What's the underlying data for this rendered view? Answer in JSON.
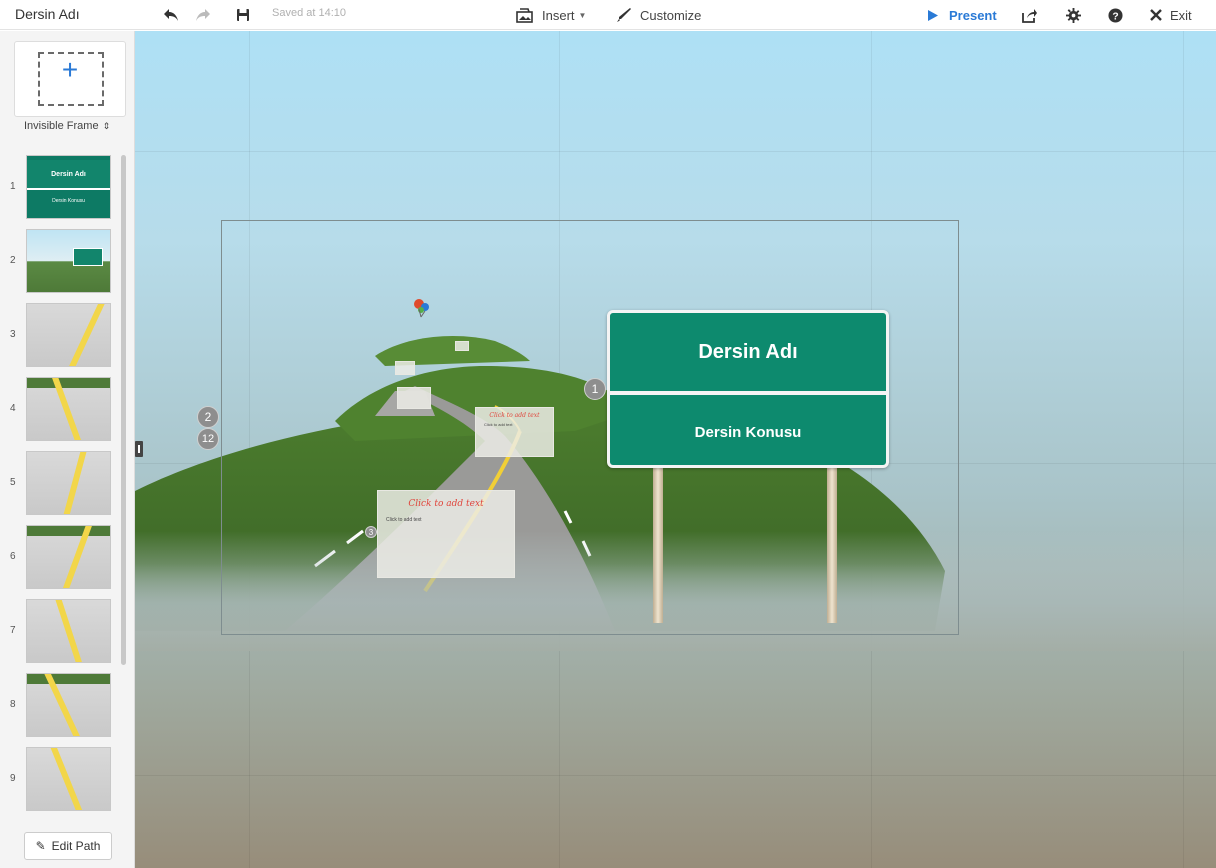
{
  "app": {
    "title": "Dersin Adı"
  },
  "toolbar": {
    "saved_text": "Saved at 14:10",
    "insert_label": "Insert",
    "customize_label": "Customize",
    "present_label": "Present",
    "exit_label": "Exit",
    "accent_color": "#2a7ad6"
  },
  "sidebar": {
    "frame_type": "Invisible Frame",
    "thumbnails": [
      {
        "number": "1",
        "title": "Dersin Adı",
        "subtitle": "Dersin Konusu"
      },
      {
        "number": "2"
      },
      {
        "number": "3"
      },
      {
        "number": "4"
      },
      {
        "number": "5"
      },
      {
        "number": "6"
      },
      {
        "number": "7"
      },
      {
        "number": "8"
      },
      {
        "number": "9"
      }
    ],
    "edit_path_label": "Edit Path"
  },
  "canvas": {
    "sign_title": "Dersin Adı",
    "sign_subtitle": "Dersin Konusu",
    "sign_color": "#0d8a6e",
    "path_badges": [
      "1",
      "2",
      "12",
      "3"
    ],
    "textframes": [
      {
        "title": "Click to add text",
        "body": "Click to add text"
      },
      {
        "title": "Click to add text",
        "body": "Click to add text"
      }
    ]
  }
}
